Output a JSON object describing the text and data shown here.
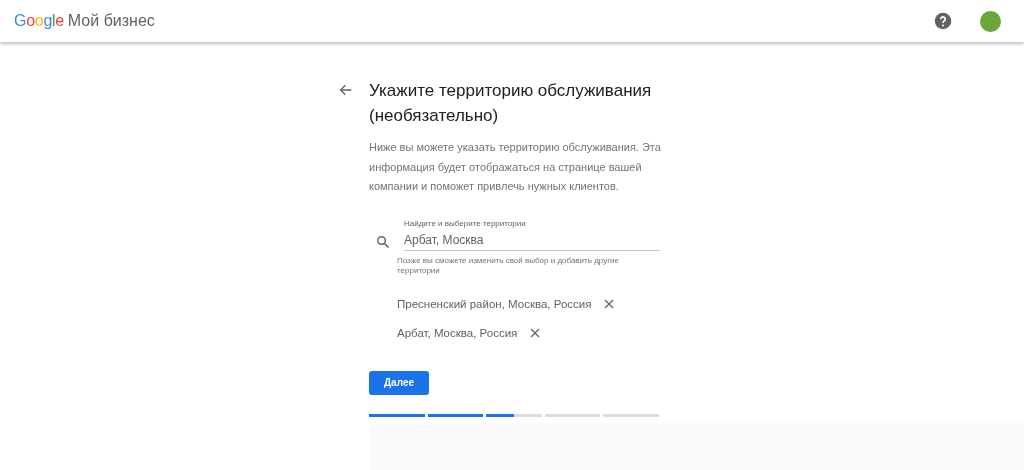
{
  "header": {
    "logo": "Google",
    "product": "Мой бизнес"
  },
  "page": {
    "title": "Укажите территорию обслуживания (необязательно)",
    "description": "Ниже вы можете указать территорию обслуживания. Эта информация будет отображаться на странице вашей компании и поможет привлечь нужных клиентов.",
    "search": {
      "label": "Найдите и выберите территории",
      "value": "Арбат, Москва",
      "hint": "Позже вы сможете изменить свой выбор и добавить другие территории"
    },
    "areas": [
      {
        "name": "Пресненский район, Москва, Россия"
      },
      {
        "name": "Арбат, Москва, Россия"
      }
    ],
    "next_button": "Далее",
    "progress": [
      {
        "level": 1
      },
      {
        "level": 1
      },
      {
        "level": 0.5
      },
      {
        "level": 0
      },
      {
        "level": 0
      }
    ]
  }
}
